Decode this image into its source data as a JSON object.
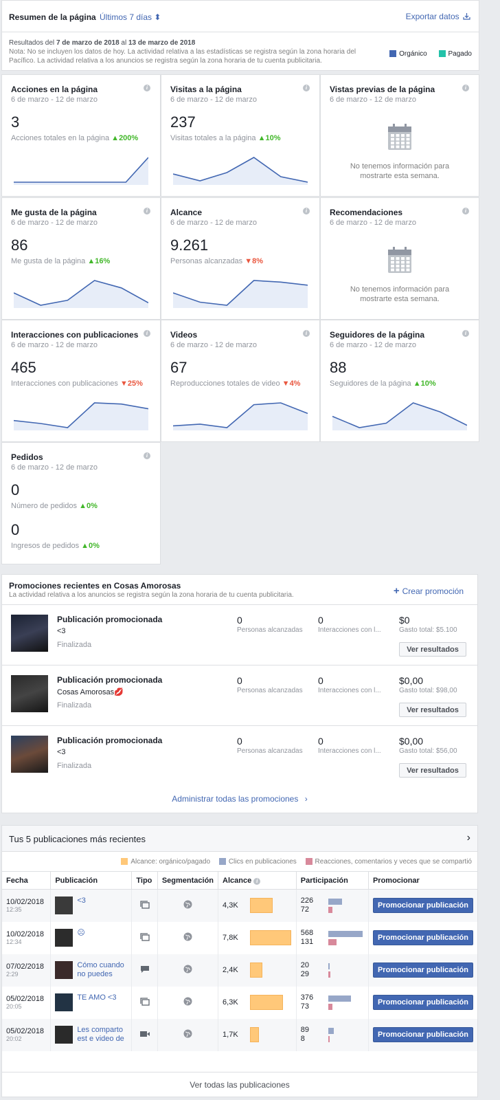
{
  "header": {
    "title": "Resumen de la página",
    "period": "Últimos 7 días ⬍",
    "export": "Exportar datos"
  },
  "results": {
    "prefix": "Resultados del ",
    "from": "7 de marzo de 2018",
    "mid": " al ",
    "to": "13 de marzo de 2018",
    "note": "Nota: No se incluyen los datos de hoy. La actividad relativa a las estadísticas se registra según la zona horaria del Pacífico. La actividad relativa a los anuncios se registra según la zona horaria de tu cuenta publicitaria.",
    "legend_organic": "Orgánico",
    "legend_paid": "Pagado",
    "color_organic": "#4267b2",
    "color_paid": "#24c2a9"
  },
  "cards": [
    {
      "title": "Acciones en la página",
      "date": "6 de marzo - 12 de marzo",
      "value": "3",
      "sub": "Acciones totales en la página",
      "delta": "200%",
      "dir": "up",
      "series": [
        0,
        0,
        0,
        0,
        0,
        0,
        3
      ]
    },
    {
      "title": "Visitas a la página",
      "date": "6 de marzo - 12 de marzo",
      "value": "237",
      "sub": "Visitas totales a la página",
      "delta": "10%",
      "dir": "up",
      "series": [
        33,
        28,
        34,
        45,
        31,
        27
      ]
    },
    {
      "title": "Vistas previas de la página",
      "date": "6 de marzo - 12 de marzo",
      "nodata": "No tenemos información para mostrarte esta semana."
    },
    {
      "title": "Me gusta de la página",
      "date": "6 de marzo - 12 de marzo",
      "value": "86",
      "sub": "Me gusta de la página",
      "delta": "16%",
      "dir": "up",
      "series": [
        14,
        9,
        11,
        19,
        16,
        10
      ]
    },
    {
      "title": "Alcance",
      "date": "6 de marzo - 12 de marzo",
      "value": "9.261",
      "sub": "Personas alcanzadas",
      "delta": "8%",
      "dir": "down",
      "series": [
        1500,
        1200,
        1100,
        1900,
        1850,
        1750
      ]
    },
    {
      "title": "Recomendaciones",
      "date": "6 de marzo - 12 de marzo",
      "nodata": "No tenemos información para mostrarte esta semana."
    },
    {
      "title": "Interacciones con publicaciones",
      "date": "6 de marzo - 12 de marzo",
      "value": "465",
      "sub": "Interacciones con publicaciones",
      "delta": "25%",
      "dir": "down",
      "series": [
        60,
        55,
        48,
        90,
        88,
        80
      ]
    },
    {
      "title": "Videos",
      "date": "6 de marzo - 12 de marzo",
      "value": "67",
      "sub": "Reproducciones totales de video",
      "delta": "4%",
      "dir": "down",
      "series": [
        5,
        6,
        4,
        17,
        18,
        12
      ]
    },
    {
      "title": "Seguidores de la página",
      "date": "6 de marzo - 12 de marzo",
      "value": "88",
      "sub": "Seguidores de la página",
      "delta": "10%",
      "dir": "up",
      "series": [
        14,
        9,
        11,
        20,
        16,
        10
      ]
    }
  ],
  "orders": {
    "title": "Pedidos",
    "date": "6 de marzo - 12 de marzo",
    "v1": "0",
    "s1": "Número de pedidos",
    "d1": "0%",
    "v2": "0",
    "s2": "Ingresos de pedidos",
    "d2": "0%"
  },
  "promotions": {
    "title": "Promociones recientes en Cosas Amorosas",
    "note": "La actividad relativa a los anuncios se registra según la zona horaria de tu cuenta publicitaria.",
    "create": "Crear promoción",
    "manage": "Administrar todas las promociones",
    "items": [
      {
        "title": "Publicación promocionada",
        "text": "<3",
        "status": "Finalizada",
        "reach": "0",
        "reach_label": "Personas alcanzadas",
        "inter": "0",
        "inter_label": "Interacciones con l...",
        "spend": "$0",
        "spend_label": "Gasto total: $5.100",
        "button": "Ver resultados"
      },
      {
        "title": "Publicación promocionada",
        "text": "Cosas Amorosas💋",
        "status": "Finalizada",
        "reach": "0",
        "reach_label": "Personas alcanzadas",
        "inter": "0",
        "inter_label": "Interacciones con l...",
        "spend": "$0,00",
        "spend_label": "Gasto total: $98,00",
        "button": "Ver resultados"
      },
      {
        "title": "Publicación promocionada",
        "text": "<3",
        "status": "Finalizada",
        "reach": "0",
        "reach_label": "Personas alcanzadas",
        "inter": "0",
        "inter_label": "Interacciones con l...",
        "spend": "$0,00",
        "spend_label": "Gasto total: $56,00",
        "button": "Ver resultados"
      }
    ]
  },
  "posts": {
    "title": "Tus 5 publicaciones más recientes",
    "legend": [
      "Alcance: orgánico/pagado",
      "Clics en publicaciones",
      "Reacciones, comentarios y veces que se compartió"
    ],
    "legend_colors": [
      "#ffc879",
      "#97a7c8",
      "#d8899b"
    ],
    "columns": [
      "Fecha",
      "Publicación",
      "Tipo",
      "Segmentación",
      "Alcance",
      "Participación",
      "Promocionar"
    ],
    "see_all": "Ver todas las publicaciones",
    "rows": [
      {
        "date": "10/02/2018",
        "time": "12:35",
        "text": "<3",
        "type": "album",
        "reach": "4,3K",
        "reach_v": 4300,
        "clicks": "226",
        "reactions": "72",
        "button": "Promocionar publicación"
      },
      {
        "date": "10/02/2018",
        "time": "12:34",
        "text": "☹",
        "type": "album",
        "reach": "7,8K",
        "reach_v": 7800,
        "clicks": "568",
        "reactions": "131",
        "button": "Promocionar publicación"
      },
      {
        "date": "07/02/2018",
        "time": "2:29",
        "text": "Cómo cuando no puedes dormir por",
        "type": "status",
        "reach": "2,4K",
        "reach_v": 2400,
        "clicks": "20",
        "reactions": "29",
        "button": "Promocionar publicación"
      },
      {
        "date": "05/02/2018",
        "time": "20:05",
        "text": "TE AMO <3",
        "type": "album",
        "reach": "6,3K",
        "reach_v": 6300,
        "clicks": "376",
        "reactions": "73",
        "button": "Promocionar publicación"
      },
      {
        "date": "05/02/2018",
        "time": "20:02",
        "text": "Les comparto est e video de esta c",
        "type": "video",
        "reach": "1,7K",
        "reach_v": 1700,
        "clicks": "89",
        "reactions": "8",
        "button": "Promocionar publicación"
      }
    ]
  }
}
